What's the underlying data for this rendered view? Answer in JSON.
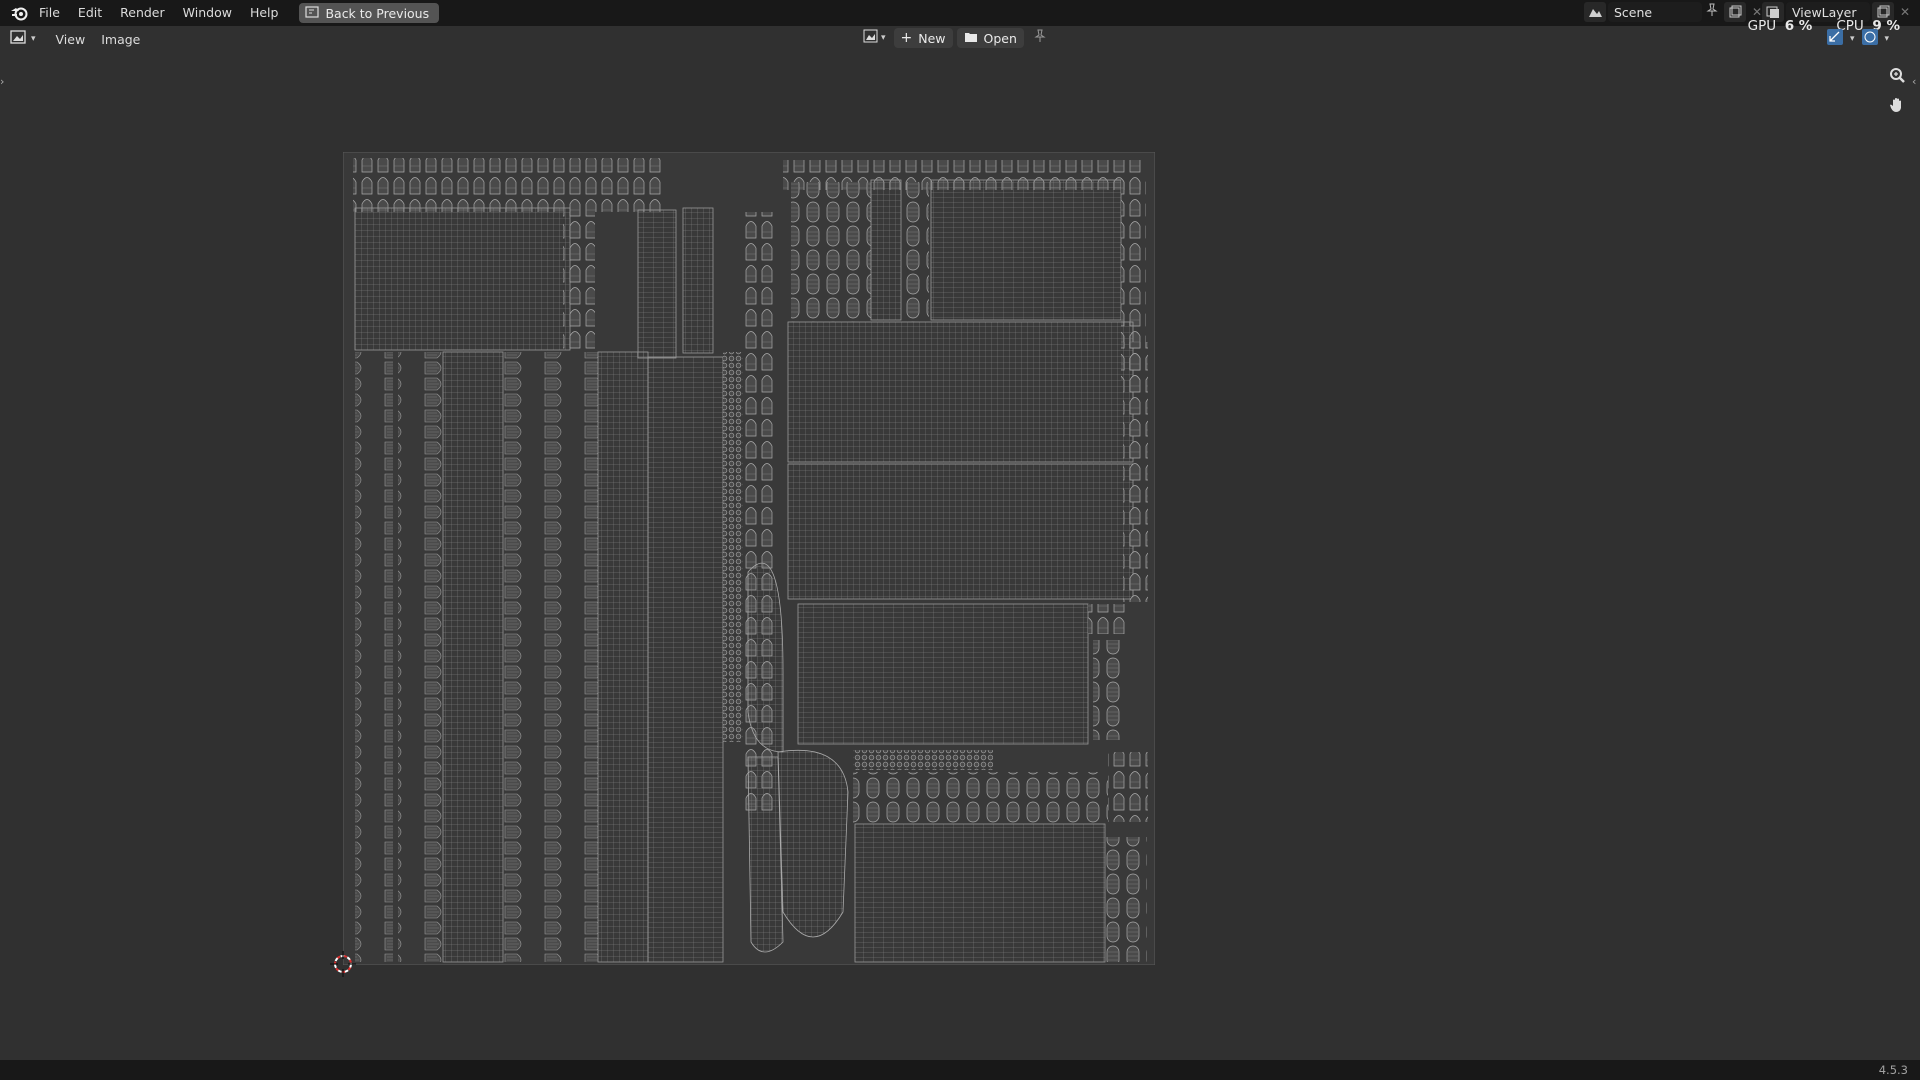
{
  "app": {
    "menus": [
      "File",
      "Edit",
      "Render",
      "Window",
      "Help"
    ],
    "back_button": "Back to Previous"
  },
  "scene": {
    "name": "Scene"
  },
  "view_layer": {
    "name": "ViewLayer"
  },
  "stats": {
    "gpu_label": "GPU",
    "gpu_value": "6 %",
    "cpu_label": "CPU",
    "cpu_value": "9 %"
  },
  "image_editor": {
    "menus": [
      "View",
      "Image"
    ],
    "new_label": "New",
    "open_label": "Open"
  },
  "footer": {
    "version": "4.5.3"
  },
  "colors": {
    "background": "#303030",
    "topbar": "#181818",
    "uv_line": "#9a9a9a",
    "uv_fill": "#3a3a3a"
  }
}
